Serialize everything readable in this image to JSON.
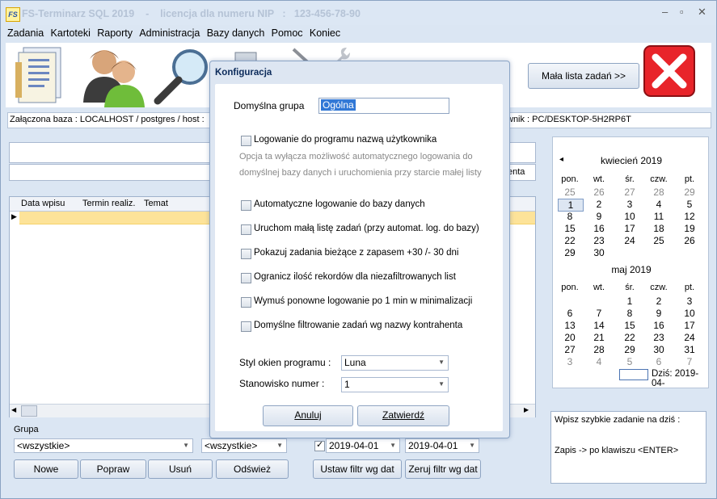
{
  "window": {
    "title": "FS-Terminarz SQL 2019    -    licencja dla numeru NIP   :   123-456-78-90",
    "app_icon": "FS",
    "minimize": "–",
    "maximize": "▫",
    "close": "✕"
  },
  "menu": [
    "Zadania",
    "Kartoteki",
    "Raporty",
    "Administracja",
    "Bazy danych",
    "Pomoc",
    "Koniec"
  ],
  "toolbar": {
    "small_list_button": "Mała lista zadań >>",
    "icons": [
      "documents-icon",
      "users-icon",
      "magnifier-icon",
      "printer-icon",
      "tools-icon",
      "wrench-icon",
      "exit-icon"
    ]
  },
  "infobar": {
    "left": "Załączona baza : LOCALHOST  / postgres / host :",
    "right": "wnik : PC/DESKTOP-5H2RP6T"
  },
  "search": {
    "right_fragment": "enta"
  },
  "grid": {
    "columns": [
      "Data wpisu",
      "Termin realiz.",
      "Temat"
    ],
    "row_marker": "▶"
  },
  "calendar": {
    "prev": "◂",
    "months": [
      {
        "name": "kwiecień 2019",
        "days_header": [
          "pon.",
          "wt.",
          "śr.",
          "czw.",
          "pt."
        ],
        "weeks": [
          [
            "25",
            "26",
            "27",
            "28",
            "29"
          ],
          [
            "1",
            "2",
            "3",
            "4",
            "5"
          ],
          [
            "8",
            "9",
            "10",
            "11",
            "12"
          ],
          [
            "15",
            "16",
            "17",
            "18",
            "19"
          ],
          [
            "22",
            "23",
            "24",
            "25",
            "26"
          ],
          [
            "29",
            "30",
            "",
            "",
            ""
          ]
        ]
      },
      {
        "name": "maj 2019",
        "days_header": [
          "pon.",
          "wt.",
          "śr.",
          "czw.",
          "pt."
        ],
        "weeks": [
          [
            "",
            "",
            "1",
            "2",
            "3"
          ],
          [
            "6",
            "7",
            "8",
            "9",
            "10"
          ],
          [
            "13",
            "14",
            "15",
            "16",
            "17"
          ],
          [
            "20",
            "21",
            "22",
            "23",
            "24"
          ],
          [
            "27",
            "28",
            "29",
            "30",
            "31"
          ],
          [
            "3",
            "4",
            "5",
            "6",
            "7"
          ]
        ]
      }
    ],
    "today_label": "Dziś: 2019-04-"
  },
  "bottom": {
    "group_label": "Grupa",
    "group_value": "<wszystkie>",
    "second_value": "<wszystkie>",
    "date_from": "2019-04-01",
    "date_to": "2019-04-01",
    "buttons": {
      "new": "Nowe",
      "edit": "Popraw",
      "delete": "Usuń",
      "refresh": "Odśwież",
      "set_filter": "Ustaw filtr wg dat",
      "reset_filter": "Zeruj filtr wg dat"
    }
  },
  "quick_task": {
    "line1": "Wpisz szybkie zadanie na dziś :",
    "line2": "Zapis ->   po klawiszu <ENTER>"
  },
  "dialog": {
    "title": "Konfiguracja",
    "default_group_label": "Domyślna grupa",
    "default_group_value": "Ogólna",
    "options": [
      "Logowanie do programu nazwą użytkownika",
      "Automatyczne logowanie do bazy danych",
      "Uruchom małą listę zadań (przy automat. log. do bazy)",
      "Pokazuj zadania bieżące z zapasem +30 /- 30 dni",
      "Ogranicz ilość rekordów dla niezafiltrowanych list",
      "Wymuś ponowne logowanie po 1 min w minimalizacji",
      "Domyślne filtrowanie zadań wg nazwy kontrahenta"
    ],
    "note_line1": "Opcja ta wyłącza możliwość automatycznego logowania do",
    "note_line2": "domyślnej bazy danych  i uruchomienia przy starcie małej listy",
    "style_label": "Styl okien programu :",
    "style_value": "Luna",
    "station_label": "Stanowisko numer :",
    "station_value": "1",
    "cancel": "Anuluj",
    "confirm": "Zatwierdź"
  }
}
